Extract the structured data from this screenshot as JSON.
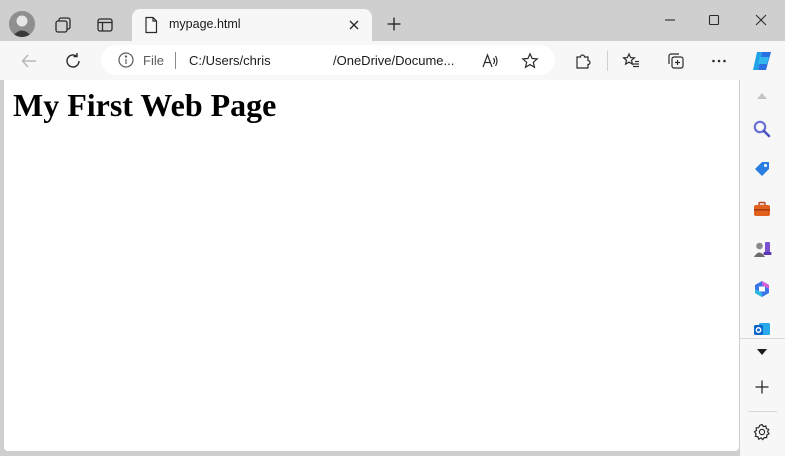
{
  "tab": {
    "title": "mypage.html"
  },
  "address": {
    "scheme_label": "File",
    "url_part1": "C:/Users/chris",
    "url_part2": "/OneDrive/Docume..."
  },
  "page": {
    "heading": "My First Web Page"
  },
  "icons": {
    "tabstrip": [
      "profile-avatar",
      "workspaces-icon",
      "tab-actions-icon",
      "file-icon",
      "close-icon",
      "plus-icon",
      "minimize-icon",
      "maximize-icon",
      "close-window-icon"
    ],
    "toolbar": [
      "back-arrow-icon",
      "refresh-icon",
      "info-icon",
      "read-aloud-icon",
      "favorite-add-icon",
      "extensions-icon",
      "favorites-icon",
      "collections-icon",
      "more-icon",
      "copilot-icon"
    ],
    "sidebar": [
      "scroll-up-icon",
      "search-icon",
      "shopping-tag-icon",
      "toolbox-icon",
      "games-icon",
      "microsoft-365-icon",
      "outlook-icon",
      "scroll-down-icon",
      "add-icon",
      "settings-icon"
    ]
  },
  "colors": {
    "chrome": "#cfcfcf",
    "toolbar": "#f7f7f7",
    "page": "#ffffff",
    "copilot": "#1fa2e8"
  }
}
